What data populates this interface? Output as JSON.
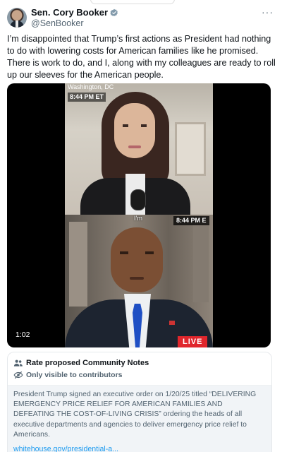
{
  "author": {
    "display_name": "Sen. Cory Booker",
    "handle": "@SenBooker",
    "verified": true,
    "more_icon": "more-horizontal-icon"
  },
  "tweet": {
    "lines": [
      "I’m disappointed that Trump’s first actions as President had nothing to do with lowering costs for American families like he promised.",
      "There is work to do, and I, along with my colleagues are ready to roll up our sleeves for the American people."
    ]
  },
  "video": {
    "top_location": "Washington, DC",
    "top_time": "8:44 PM ET",
    "caption_word": "I’m",
    "bottom_time": "8:44 PM E",
    "live_label": "LIVE",
    "duration": "1:02"
  },
  "community_notes": {
    "title": "Rate proposed Community Notes",
    "subtitle": "Only visible to contributors",
    "note_text": "President Trump signed an executive order on 1/20/25 titled “DELIVERING EMERGENCY PRICE RELIEF FOR AMERICAN FAMILIES AND DEFEATING THE COST-OF-LIVING CRISIS” ordering the heads of all executive departments and agencies to deliver emergency price relief to Americans.",
    "link_text": "whitehouse.gov/presidential-a..."
  },
  "colors": {
    "accent": "#1d9bf0",
    "live": "#e0262c",
    "secondary_text": "#536471"
  }
}
